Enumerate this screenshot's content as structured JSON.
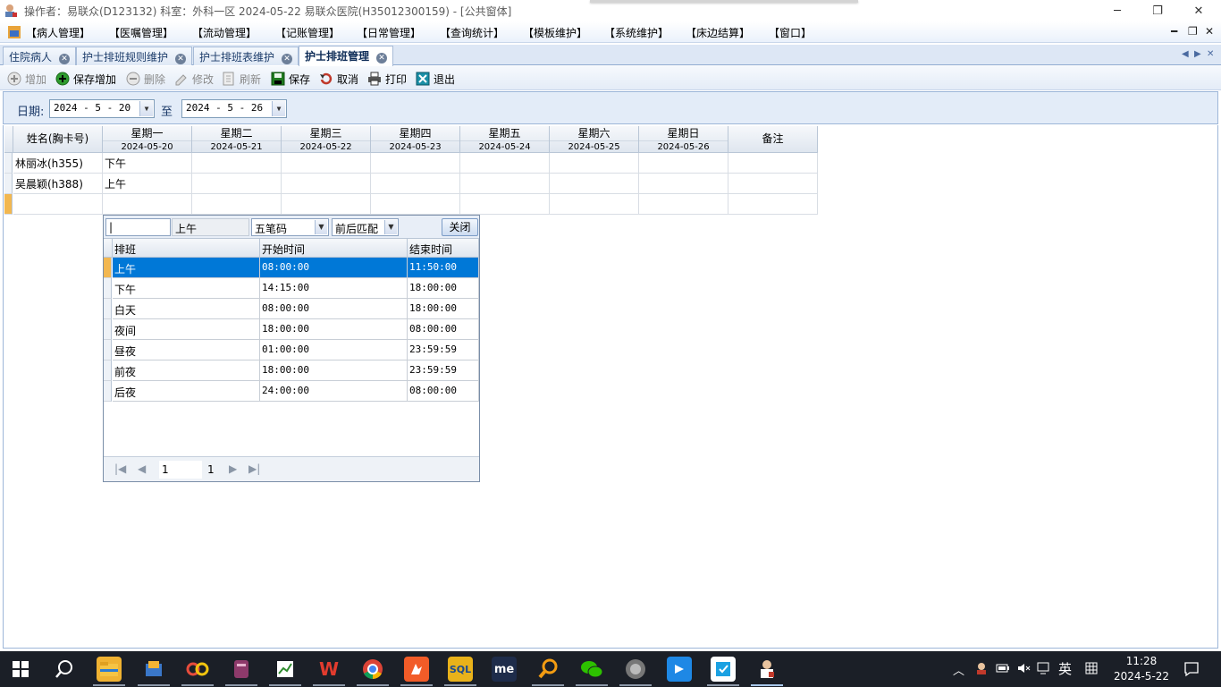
{
  "window": {
    "title": "操作者：易联众(D123132)  科室：外科一区  2024-05-22  易联众医院(H35012300159) - [公共窗体]",
    "controls": [
      "─",
      "❐",
      "✕"
    ]
  },
  "menu": {
    "items": [
      "【病人管理】",
      "【医嘱管理】",
      "【流动管理】",
      "【记账管理】",
      "【日常管理】",
      "【查询统计】",
      "【模板维护】",
      "【系统维护】",
      "【床边结算】",
      "【窗口】"
    ],
    "mdi_controls": [
      "━",
      "❐",
      "✕"
    ]
  },
  "tabs": [
    {
      "label": "住院病人",
      "active": false
    },
    {
      "label": "护士排班规则维护",
      "active": false
    },
    {
      "label": "护士排班表维护",
      "active": false
    },
    {
      "label": "护士排班管理",
      "active": true
    }
  ],
  "tab_nav": [
    "◀",
    "▶",
    "✕"
  ],
  "toolbar": {
    "buttons": [
      {
        "label": "增加",
        "icon": "add-icon",
        "enabled": false
      },
      {
        "label": "保存增加",
        "icon": "save-add-icon",
        "enabled": true
      },
      {
        "label": "删除",
        "icon": "delete-icon",
        "enabled": false
      },
      {
        "label": "修改",
        "icon": "edit-icon",
        "enabled": false
      },
      {
        "label": "刷新",
        "icon": "refresh-icon",
        "enabled": false
      },
      {
        "label": "保存",
        "icon": "save-icon",
        "enabled": true
      },
      {
        "label": "取消",
        "icon": "cancel-icon",
        "enabled": true
      },
      {
        "label": "打印",
        "icon": "print-icon",
        "enabled": true
      },
      {
        "label": "退出",
        "icon": "exit-icon",
        "enabled": true
      }
    ]
  },
  "filter": {
    "date_label": "日期:",
    "from": "2024 - 5 - 20",
    "to_label": "至",
    "to": "2024 - 5 - 26"
  },
  "schedule": {
    "name_header": "姓名(胸卡号)",
    "note_header": "备注",
    "days": [
      {
        "weekday": "星期一",
        "date": "2024-05-20"
      },
      {
        "weekday": "星期二",
        "date": "2024-05-21"
      },
      {
        "weekday": "星期三",
        "date": "2024-05-22"
      },
      {
        "weekday": "星期四",
        "date": "2024-05-23"
      },
      {
        "weekday": "星期五",
        "date": "2024-05-24"
      },
      {
        "weekday": "星期六",
        "date": "2024-05-25"
      },
      {
        "weekday": "星期日",
        "date": "2024-05-26"
      }
    ],
    "rows": [
      {
        "name": "林丽冰(h355)",
        "shifts": [
          "下午",
          "",
          "",
          "",
          "",
          "",
          ""
        ],
        "note": ""
      },
      {
        "name": "吴晨颖(h388)",
        "shifts": [
          "上午",
          "",
          "",
          "",
          "",
          "",
          ""
        ],
        "note": ""
      },
      {
        "name": "",
        "shifts": [
          "",
          "",
          "",
          "",
          "",
          "",
          ""
        ],
        "note": ""
      }
    ]
  },
  "popup": {
    "search_value": "|",
    "current_value": "上午",
    "input_method": "五笔码",
    "match_mode": "前后匹配",
    "close_label": "关闭",
    "columns": [
      "排班",
      "开始时间",
      "结束时间"
    ],
    "rows": [
      {
        "shift": "上午",
        "start": "08:00:00",
        "end": "11:50:00",
        "selected": true
      },
      {
        "shift": "下午",
        "start": "14:15:00",
        "end": "18:00:00",
        "selected": false
      },
      {
        "shift": "白天",
        "start": "08:00:00",
        "end": "18:00:00",
        "selected": false
      },
      {
        "shift": "夜间",
        "start": "18:00:00",
        "end": "08:00:00",
        "selected": false
      },
      {
        "shift": "昼夜",
        "start": "01:00:00",
        "end": "23:59:59",
        "selected": false
      },
      {
        "shift": "前夜",
        "start": "18:00:00",
        "end": "23:59:59",
        "selected": false
      },
      {
        "shift": "后夜",
        "start": "24:00:00",
        "end": "08:00:00",
        "selected": false
      }
    ],
    "pager": {
      "page": "1",
      "total": "1"
    }
  },
  "taskbar": {
    "apps": [
      "file-explorer",
      "app-2",
      "app-3",
      "app-4",
      "app-5",
      "wps",
      "chrome",
      "app-8",
      "sql",
      "me",
      "search-app",
      "wechat",
      "app-13",
      "app-14",
      "app-15",
      "app-16"
    ],
    "ime": "英",
    "time": "11:28",
    "date": "2024-5-22"
  }
}
